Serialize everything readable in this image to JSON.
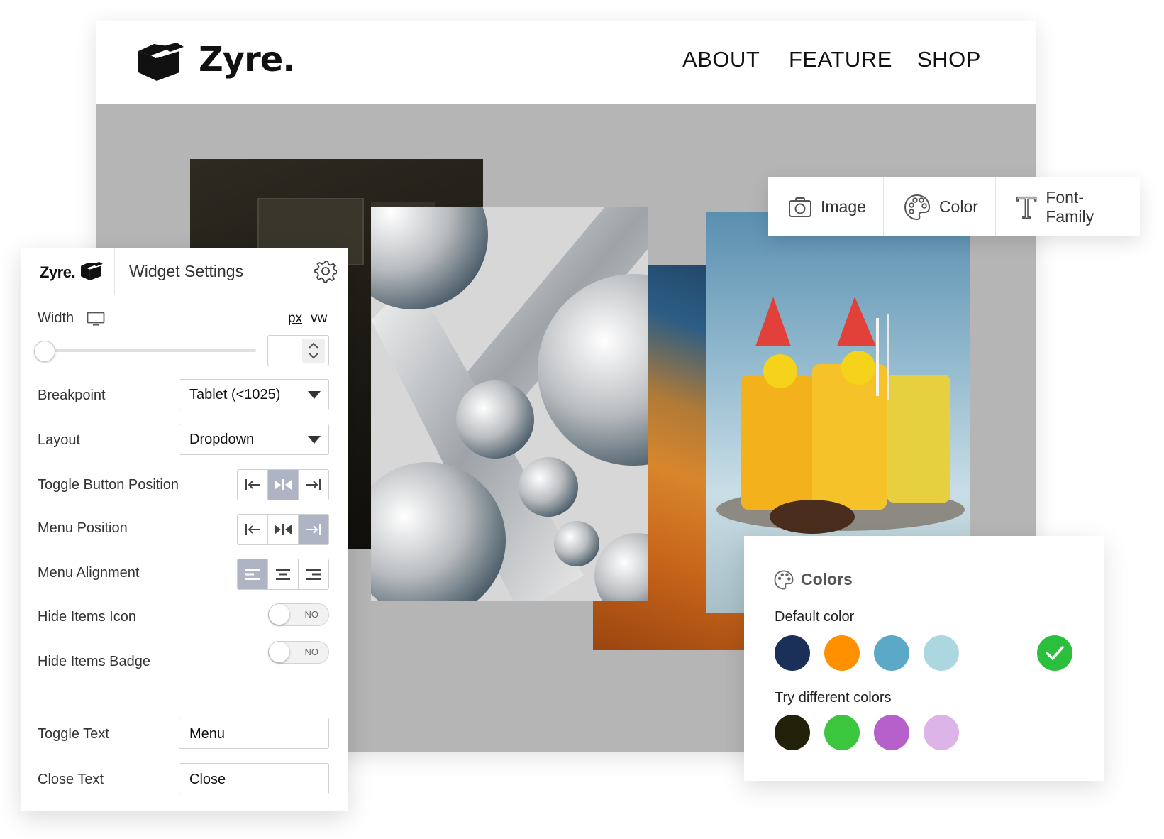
{
  "site": {
    "brand": "Zyre.",
    "nav": [
      "ABOUT",
      "FEATURE",
      "SHOP"
    ]
  },
  "toolbar": {
    "items": [
      {
        "label": "Image",
        "icon": "camera-icon"
      },
      {
        "label": "Color",
        "icon": "palette-icon"
      },
      {
        "label": "Font-Family",
        "icon": "text-icon"
      }
    ]
  },
  "colors_panel": {
    "title": "Colors",
    "default_label": "Default color",
    "default_colors": [
      "#1b3059",
      "#ff9000",
      "#5ba9c7",
      "#acd7e1"
    ],
    "selected_badge_color": "#2bbf3e",
    "try_label": "Try different colors",
    "try_colors": [
      "#22220a",
      "#3cc63d",
      "#b660cc",
      "#ddb4e7"
    ]
  },
  "widget": {
    "brand": "Zyre.",
    "title": "Widget Settings",
    "width": {
      "label": "Width",
      "unit_px": "px",
      "unit_vw": "vw",
      "value": ""
    },
    "breakpoint": {
      "label": "Breakpoint",
      "value": "Tablet (<1025)"
    },
    "layout": {
      "label": "Layout",
      "value": "Dropdown"
    },
    "toggle_button_position": {
      "label": "Toggle Button Position",
      "options": [
        "left",
        "center",
        "right"
      ],
      "active": "center"
    },
    "menu_position": {
      "label": "Menu Position",
      "options": [
        "left",
        "center",
        "right"
      ],
      "active": "right"
    },
    "menu_alignment": {
      "label": "Menu Alignment",
      "options": [
        "left",
        "center",
        "right"
      ],
      "active": "left"
    },
    "hide_items_icon": {
      "label": "Hide Items Icon",
      "state": "NO"
    },
    "hide_items_badge": {
      "label": "Hide Items Badge",
      "state": "NO"
    },
    "toggle_text": {
      "label": "Toggle Text",
      "value": "Menu"
    },
    "close_text": {
      "label": "Close Text",
      "value": "Close"
    }
  }
}
